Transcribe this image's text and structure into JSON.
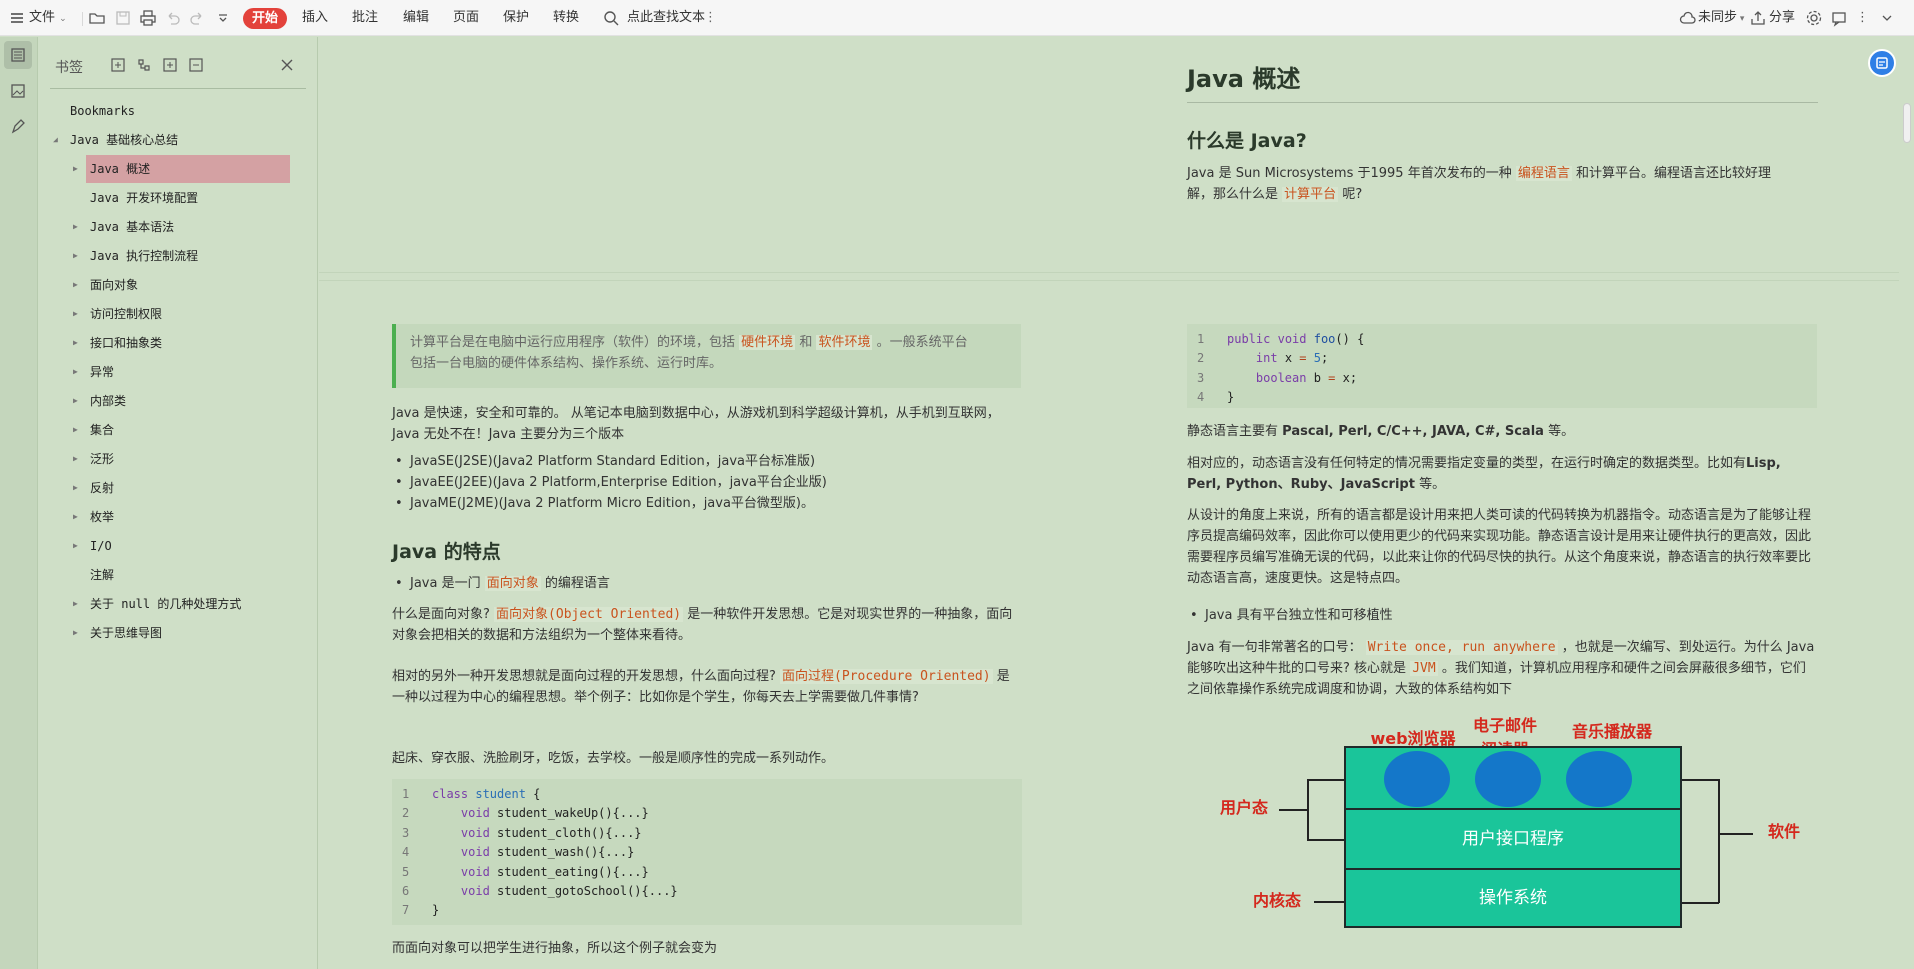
{
  "toolbar": {
    "file_label": "文件",
    "start_label": "开始",
    "menus": [
      "插入",
      "批注",
      "编辑",
      "页面",
      "保护",
      "转换"
    ],
    "search_text": "点此查找文本",
    "sync_label": "未同步",
    "share_label": "分享",
    "accent_color": "#e3423b"
  },
  "panel": {
    "title": "书签",
    "items": [
      {
        "label": "Bookmarks",
        "level": 0,
        "caret": false
      },
      {
        "label": "Java 基础核心总结",
        "level": 0,
        "caret": true,
        "expanded": true
      },
      {
        "label": "Java 概述",
        "level": 1,
        "caret": true,
        "selected": true
      },
      {
        "label": "Java 开发环境配置",
        "level": 1,
        "caret": false
      },
      {
        "label": "Java 基本语法",
        "level": 1,
        "caret": true
      },
      {
        "label": "Java 执行控制流程",
        "level": 1,
        "caret": true
      },
      {
        "label": "面向对象",
        "level": 1,
        "caret": true
      },
      {
        "label": "访问控制权限",
        "level": 1,
        "caret": true
      },
      {
        "label": "接口和抽象类",
        "level": 1,
        "caret": true
      },
      {
        "label": "异常",
        "level": 1,
        "caret": true
      },
      {
        "label": "内部类",
        "level": 1,
        "caret": true
      },
      {
        "label": "集合",
        "level": 1,
        "caret": true
      },
      {
        "label": "泛形",
        "level": 1,
        "caret": true
      },
      {
        "label": "反射",
        "level": 1,
        "caret": true
      },
      {
        "label": "枚举",
        "level": 1,
        "caret": true
      },
      {
        "label": "I/O",
        "level": 1,
        "caret": true
      },
      {
        "label": "注解",
        "level": 1,
        "caret": false
      },
      {
        "label": "关于 null 的几种处理方式",
        "level": 1,
        "caret": true
      },
      {
        "label": "关于思维导图",
        "level": 1,
        "caret": true
      }
    ]
  },
  "doc": {
    "page1": {
      "title": "Java 概述",
      "section": "什么是 Java?",
      "para_a": "Java 是 Sun Microsystems 于1995 年首次发布的一种",
      "hl_lang": "编程语言",
      "para_b": "和计算平台。编程语言还比较好理",
      "para_c": "解，那么什么是",
      "hl_platform": "计算平台",
      "para_d": "呢?"
    },
    "left": {
      "quote_a": "计算平台是在电脑中运行应用程序（软件）的环境，包括",
      "quote_hw": "硬件环境",
      "quote_and": "和",
      "quote_sw": "软件环境",
      "quote_b": "。一般系统平台",
      "quote_c": "包括一台电脑的硬件体系结构、操作系统、运行时库。",
      "intro": "Java 是快速，安全和可靠的。 从笔记本电脑到数据中心，从游戏机到科学超级计算机，从手机到互联网，Java 无处不在！Java 主要分为三个版本",
      "editions": [
        "JavaSE(J2SE)(Java2 Platform Standard Edition，java平台标准版)",
        "JavaEE(J2EE)(Java 2 Platform,Enterprise Edition，java平台企业版)",
        "JavaME(J2ME)(Java 2 Platform Micro Edition，java平台微型版)。"
      ],
      "features_heading": "Java 的特点",
      "feat_a": "Java 是一门",
      "feat_hl": "面向对象",
      "feat_b": "的编程语言",
      "oo_a": "什么是面向对象?",
      "oo_hl": "面向对象(Object Oriented)",
      "oo_b": "是一种软件开发思想。它是对现实世界的一种抽象，面向对象会把相关的数据和方法组织为一个整体来看待。",
      "po_a": "相对的另外一种开发思想就是面向过程的开发思想，什么面向过程?",
      "po_hl": "面向过程(Procedure Oriented)",
      "po_b": "是一种以过程为中心的编程思想。举个例子：比如你是个学生，你每天去上学需要做几件事情?",
      "daily": "起床、穿衣服、洗脸刷牙，吃饭，去学校。一般是顺序性的完成一系列动作。",
      "code": [
        {
          "n": "1",
          "kw": "class",
          "rest": " ",
          "ty": "student",
          "tail": " {"
        },
        {
          "n": "2",
          "kw": "    void",
          "rest": " student_wakeUp(){...}"
        },
        {
          "n": "3",
          "kw": "    void",
          "rest": " student_cloth(){...}"
        },
        {
          "n": "4",
          "kw": "    void",
          "rest": " student_wash(){...}"
        },
        {
          "n": "5",
          "kw": "    void",
          "rest": " student_eating(){...}"
        },
        {
          "n": "6",
          "kw": "    void",
          "rest": " student_gotoSchool(){...}"
        },
        {
          "n": "7",
          "kw": "",
          "rest": "}"
        }
      ],
      "abstract": "而面向对象可以把学生进行抽象，所以这个例子就会变为"
    },
    "right": {
      "code": [
        {
          "n": "1",
          "text": "public void foo() {"
        },
        {
          "n": "2",
          "text": "    int x = 5;"
        },
        {
          "n": "3",
          "text": "    boolean b = x;"
        },
        {
          "n": "4",
          "text": "}"
        }
      ],
      "static_a": "静态语言主要有",
      "static_langs": "Pascal, Perl, C/C++, JAVA, C#, Scala",
      "static_b": "等。",
      "dyn_a": "相对应的，动态语言没有任何特定的情况需要指定变量的类型，在运行时确定的数据类型。比如有",
      "dyn_langs1": "Lisp,",
      "dyn_langs2": "Perl, Python、Ruby、JavaScript",
      "dyn_b": "等。",
      "design": "从设计的角度上来说，所有的语言都是设计用来把人类可读的代码转换为机器指令。动态语言是为了能够让程序员提高编码效率，因此你可以使用更少的代码来实现功能。静态语言设计是用来让硬件执行的更高效，因此需要程序员编写准确无误的代码，以此来让你的代码尽快的执行。从这个角度来说，静态语言的执行效率要比动态语言高，速度更快。这是特点四。",
      "portable": "Java 具有平台独立性和可移植性",
      "slogan_a": "Java 有一句非常著名的口号：",
      "slogan_hl": "Write once, run anywhere",
      "slogan_b": "，也就是一次编写、到处运行。为什么 Java 能够吹出这种牛批的口号来? 核心就是",
      "jvm": "JVM",
      "slogan_c": "。我们知道，计算机应用程序和硬件之间会屏蔽很多细节，它们之间依靠操作系统完成调度和协调，大致的体系结构如下"
    },
    "diagram": {
      "app1": "web浏览器",
      "app2_l1": "电子邮件",
      "app2_l2": "阅读器",
      "app3": "音乐播放器",
      "user_mode": "用户态",
      "kernel_mode": "内核态",
      "software": "软件",
      "ui_layer": "用户接口程序",
      "os_layer": "操作系统"
    }
  }
}
